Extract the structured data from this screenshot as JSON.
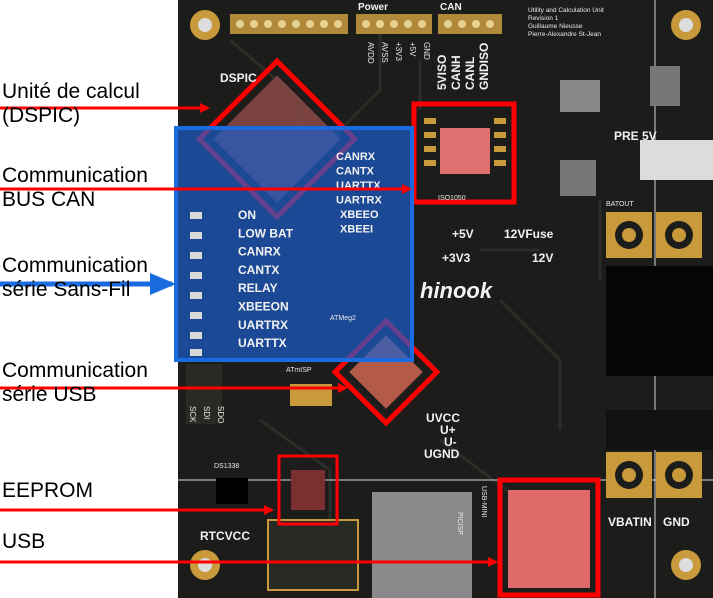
{
  "labels": {
    "dspic_line1": "Unité de calcul",
    "dspic_line2": "(DSPIC)",
    "can_line1": "Communication",
    "can_line2": "BUS CAN",
    "wireless_line1": "Communication",
    "wireless_line2": "série Sans-Fil",
    "usb_serial_line1": "Communication",
    "usb_serial_line2": "série USB",
    "eeprom": "EEPROM",
    "usb": "USB"
  },
  "pcb": {
    "header_left": "DSPIC",
    "power_header": "Power",
    "can_header": "CAN",
    "power_pins": [
      "AVDD",
      "AVSS",
      "+3V3",
      "+5V",
      "GND"
    ],
    "can_pins": [
      "5VISO",
      "CANH",
      "CANL",
      "GNDISO"
    ],
    "title_block": [
      "Utility and Calculation Unit",
      "Revision 1",
      "Guillaume Nieusse",
      "Pierre-Alexandre St-Jean"
    ],
    "status_signals": [
      "CANRX",
      "CANTX",
      "UARTTX",
      "UARTRX",
      "XBEEO",
      "XBEEI"
    ],
    "leds": [
      "ON",
      "LOW BAT",
      "CANRX",
      "CANTX",
      "RELAY",
      "XBEEON",
      "UARTRX",
      "UARTTX"
    ],
    "rail_labels": [
      "+5V",
      "12VFuse",
      "+3V3",
      "12V"
    ],
    "brand": "hinook",
    "pre5v": "PRE 5V",
    "batout": "BATOUT",
    "usb_pins": [
      "UVCC",
      "U+",
      "U-",
      "UGND"
    ],
    "vbatin": "VBATIN",
    "gnd": "GND",
    "rtcvcc": "RTCVCC",
    "atmega_label": "ATMeg2",
    "iso_label": "ISO1050",
    "ds1338": "DS1338",
    "spi_pins": [
      "SCK",
      "SDI",
      "SDO"
    ],
    "connector_labels": [
      "ATmISP",
      "PICISP",
      "USB-MINI"
    ]
  },
  "colors": {
    "pcb": "#1c1d1a",
    "silk": "#f2f2f2",
    "copper": "#cfa24a",
    "highlight_red": "#ff0000",
    "highlight_blue": "#1a6be0",
    "arrow_red": "#ff0000",
    "arrow_blue": "#1a6be0"
  }
}
